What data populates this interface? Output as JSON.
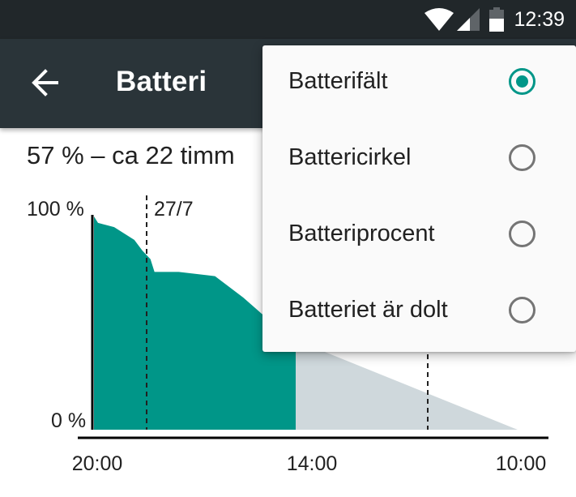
{
  "status_bar": {
    "time": "12:39",
    "icons": [
      "wifi-icon",
      "signal-icon",
      "battery-icon"
    ]
  },
  "app_bar": {
    "title": "Batteri",
    "back_icon": "arrow-left-icon"
  },
  "summary": "57 % – ca 22 timm",
  "chart_data": {
    "type": "area",
    "ylabel_top": "100 %",
    "ylabel_bottom": "0 %",
    "ylim": [
      0,
      100
    ],
    "x_tick_labels": [
      "20:00",
      "14:00",
      "10:00"
    ],
    "date_marker": "27/7",
    "series": [
      {
        "kind": "history",
        "color": "#009688",
        "points": [
          [
            0.0,
            100
          ],
          [
            0.02,
            97
          ],
          [
            0.06,
            96
          ],
          [
            0.1,
            95
          ],
          [
            0.15,
            92
          ],
          [
            0.2,
            89
          ],
          [
            0.24,
            84
          ],
          [
            0.28,
            80
          ],
          [
            0.3,
            74
          ],
          [
            0.42,
            74
          ],
          [
            0.6,
            72
          ],
          [
            0.74,
            62
          ],
          [
            0.86,
            52
          ],
          [
            0.97,
            43
          ],
          [
            1.0,
            42
          ]
        ]
      },
      {
        "kind": "prediction",
        "color": "#cfd8dc",
        "points": [
          [
            1.0,
            42
          ],
          [
            2.1,
            0
          ]
        ]
      }
    ]
  },
  "menu": {
    "items": [
      {
        "label": "Batterifält",
        "checked": true
      },
      {
        "label": "Battericirkel",
        "checked": false
      },
      {
        "label": "Batteriprocent",
        "checked": false
      },
      {
        "label": "Batteriet är dolt",
        "checked": false
      }
    ]
  }
}
